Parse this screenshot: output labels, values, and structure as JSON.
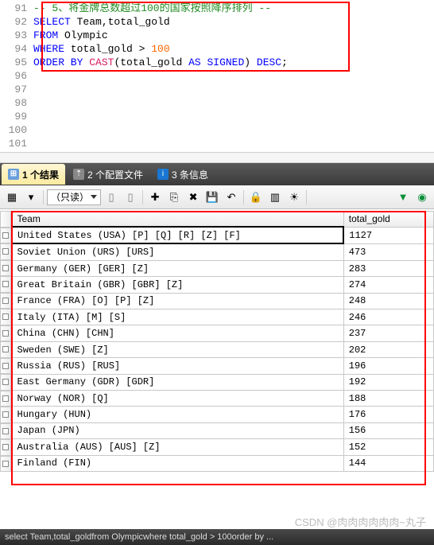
{
  "code": {
    "lines": [
      {
        "num": "91",
        "html": [
          {
            "c": "kw-green",
            "t": "-- 5、将金牌总数超过100的国家按照降序排列 --"
          }
        ]
      },
      {
        "num": "92",
        "html": [
          {
            "c": "kw-blue",
            "t": "SELECT"
          },
          {
            "c": "kw-black",
            "t": " Team,total_gold"
          }
        ]
      },
      {
        "num": "93",
        "html": [
          {
            "c": "kw-blue",
            "t": "FROM"
          },
          {
            "c": "kw-black",
            "t": " Olympic"
          }
        ]
      },
      {
        "num": "94",
        "html": [
          {
            "c": "kw-blue",
            "t": "WHERE"
          },
          {
            "c": "kw-black",
            "t": " total_gold > "
          },
          {
            "c": "kw-num",
            "t": "100"
          }
        ]
      },
      {
        "num": "95",
        "html": [
          {
            "c": "kw-blue",
            "t": "ORDER BY "
          },
          {
            "c": "kw-pink",
            "t": "CAST"
          },
          {
            "c": "kw-black",
            "t": "(total_gold "
          },
          {
            "c": "kw-blue",
            "t": "AS SIGNED"
          },
          {
            "c": "kw-black",
            "t": ") "
          },
          {
            "c": "kw-blue",
            "t": "DESC"
          },
          {
            "c": "kw-black",
            "t": ";"
          }
        ]
      },
      {
        "num": "96",
        "html": []
      },
      {
        "num": "97",
        "html": []
      },
      {
        "num": "98",
        "html": []
      },
      {
        "num": "99",
        "html": []
      },
      {
        "num": "100",
        "html": []
      },
      {
        "num": "101",
        "html": []
      }
    ]
  },
  "tabs": {
    "results": "1 个结果",
    "profiles": "2 个配置文件",
    "messages": "3 条信息"
  },
  "toolbar": {
    "readonly": "（只读）",
    "icons": [
      "grid-icon",
      "sep",
      "combo",
      "sep",
      "nav-first",
      "nav-up",
      "sep",
      "add",
      "copy",
      "delete",
      "save",
      "cancel",
      "sep",
      "lock",
      "chart",
      "highlight",
      "sep",
      "filter",
      "export"
    ]
  },
  "grid": {
    "columns": [
      "Team",
      "total_gold"
    ],
    "rows": [
      {
        "team": "United States (USA) [P] [Q] [R] [Z] [F]",
        "gold": "1127",
        "selected": true
      },
      {
        "team": "Soviet Union (URS) [URS]",
        "gold": "473"
      },
      {
        "team": "Germany (GER) [GER] [Z]",
        "gold": "283"
      },
      {
        "team": "Great Britain (GBR) [GBR] [Z]",
        "gold": "274"
      },
      {
        "team": "France (FRA) [O] [P] [Z]",
        "gold": "248"
      },
      {
        "team": "Italy (ITA) [M] [S]",
        "gold": "246"
      },
      {
        "team": "China (CHN) [CHN]",
        "gold": "237"
      },
      {
        "team": "Sweden (SWE) [Z]",
        "gold": "202"
      },
      {
        "team": "Russia (RUS) [RUS]",
        "gold": "196"
      },
      {
        "team": "East Germany (GDR) [GDR]",
        "gold": "192"
      },
      {
        "team": "Norway (NOR) [Q]",
        "gold": "188"
      },
      {
        "team": "Hungary (HUN)",
        "gold": "176"
      },
      {
        "team": "Japan (JPN)",
        "gold": "156"
      },
      {
        "team": "Australia (AUS) [AUS] [Z]",
        "gold": "152"
      },
      {
        "team": "Finland (FIN)",
        "gold": "144"
      }
    ]
  },
  "watermark": "CSDN @肉肉肉肉肉肉~丸子",
  "status": "select Team,total_goldfrom Olympicwhere total_gold > 100order by ..."
}
